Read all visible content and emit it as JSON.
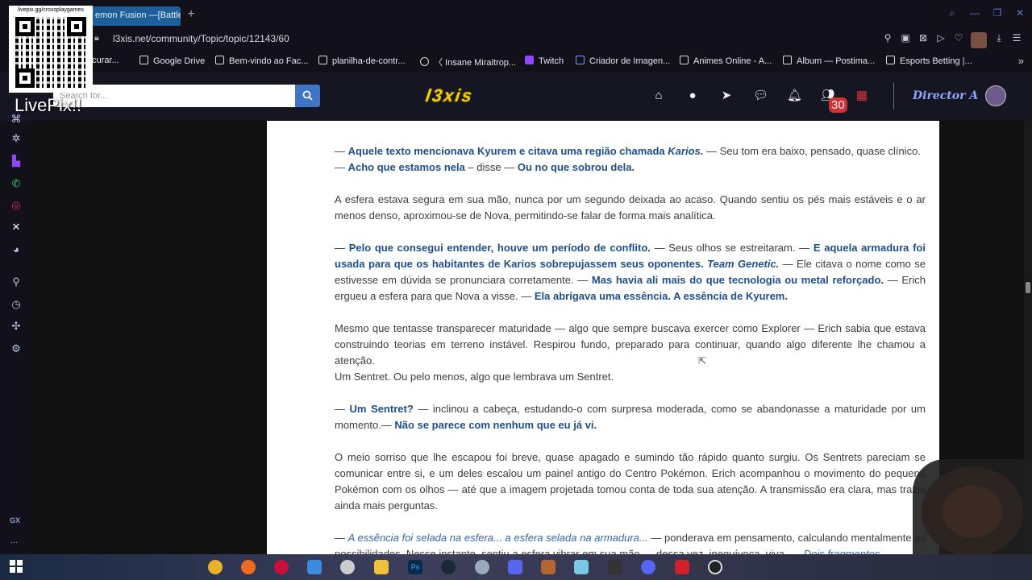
{
  "browser": {
    "tab_title": "emon Fusion —[Battle",
    "new_tab": "+",
    "url": "l3xis.net/community/Topic/topic/12143/60",
    "bookmarks": [
      "ocurar...",
      "Google Drive",
      "Bem-vindo ao Fac...",
      "planilha-de-contr...",
      "〈 Insane Miraitrop...",
      "Twitch",
      "Criador de Imagen...",
      "Animes Online - A...",
      "Album — Postima...",
      "Esports Betting |..."
    ],
    "bookmarks_more": "»"
  },
  "site": {
    "search_placeholder": "Search for...",
    "logo": "l3xis",
    "notification_badge": "30",
    "username": "Director A"
  },
  "overlay": {
    "qr_label": "livepix.gg/crossplaygames",
    "live_text": "LivePix!!"
  },
  "sidebar": {
    "gx_label": "GX",
    "more": "..."
  },
  "article": {
    "p1": {
      "a": "— ",
      "b1": "Aquele texto mencionava Kyurem e citava uma região chamada ",
      "i1": "Karios.",
      "c": " — Seu tom era baixo, pensado, quase clínico.",
      "d": "— ",
      "b2": "Acho que estamos nela",
      "e": " – disse — ",
      "b3": "Ou no que sobrou dela."
    },
    "p2": "A esfera estava segura em sua mão, nunca por um segundo deixada ao acaso. Quando sentiu os pés mais estáveis e o ar menos denso, aproximou-se de Nova, permitindo-se falar de forma mais analítica.",
    "p3": {
      "a": "— ",
      "b1": "Pelo que consegui entender, houve um período de conflito.",
      "c": " — Seus olhos se estreitaram. — ",
      "b2": "E aquela armadura foi usada para que os habitantes de Karios sobrepujassem seus oponentes. ",
      "i1": "Team Genetic.",
      "d": " — Ele citava o nome como se estivesse em dúvida se pronunciara corretamente. — ",
      "b3": "Mas havia ali mais do que tecnologia ou metal reforçado.",
      "e": " — Erich ergueu a esfera para que Nova a visse. — ",
      "b4": "Ela abrigava uma essência. A essência de Kyurem."
    },
    "p4": "Mesmo que tentasse transparecer maturidade — algo que sempre buscava exercer como Explorer — Erich sabia que estava construindo teorias em terreno instável. Respirou fundo, preparado para continuar, quando algo diferente lhe chamou a atenção.",
    "p4b": "Um Sentret. Ou pelo menos, algo que lembrava um Sentret.",
    "p5": {
      "a": "— ",
      "b1": "Um Sentret?",
      "c": " — inclinou a cabeça, estudando-o com surpresa moderada, como se abandonasse a maturidade por um momento.— ",
      "b2": "Não se parece com nenhum que eu já vi."
    },
    "p6": "O meio sorriso que lhe escapou foi breve, quase apagado e sumindo tão rápido quanto surgiu. Os Sentrets pareciam se comunicar entre si, e um deles escalou um painel antigo do Centro Pokémon. Erich acompanhou o movimento do pequeno Pokémon com os olhos — até que a imagem projetada tomou conta de toda sua atenção. A transmissão era clara, mas trazia ainda mais perguntas.",
    "p7": {
      "a": "— ",
      "i1": "A essência foi selada na esfera... a esfera selada na armadura...",
      "c": " — ponderava em pensamento, calculando mentalmente as possibilidades. Nesse instante, sentiu a esfera vibrar em sua mão — dessa vez, inequívoca, viva. — ",
      "i2": "Dois fragmentos"
    }
  },
  "colors": {
    "accent": "#1f4e8c",
    "tab_active": "#1d5f98",
    "search_button": "#3f74c7",
    "logo": "#f3d300",
    "username": "#8fa8ff"
  }
}
